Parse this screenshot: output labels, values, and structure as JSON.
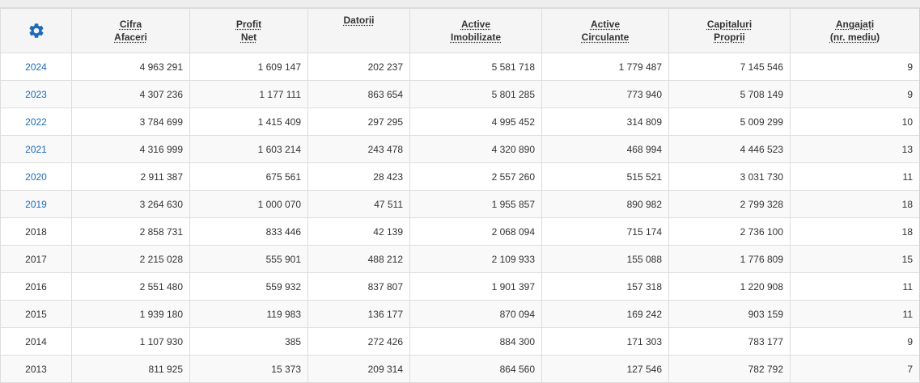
{
  "colors": {
    "accent": "#1e6bb8",
    "header_bg": "#f5f5f5",
    "border": "#dddddd",
    "text": "#333333"
  },
  "settings": {
    "icon": "gear-icon"
  },
  "columns": [
    {
      "key": "cifra_afaceri",
      "line1": "Cifra",
      "line2": "Afaceri"
    },
    {
      "key": "profit_net",
      "line1": "Profit",
      "line2": "Net"
    },
    {
      "key": "datorii",
      "line1": "Datorii",
      "line2": ""
    },
    {
      "key": "active_imobilizate",
      "line1": "Active",
      "line2": "Imobilizate"
    },
    {
      "key": "active_circulante",
      "line1": "Active",
      "line2": "Circulante"
    },
    {
      "key": "capitaluri_proprii",
      "line1": "Capitaluri",
      "line2": "Proprii"
    },
    {
      "key": "angajati",
      "line1": "Angajați",
      "line2": "(nr. mediu)"
    }
  ],
  "rows": [
    {
      "year": "2024",
      "link": true,
      "values": [
        "4 963 291",
        "1 609 147",
        "202 237",
        "5 581 718",
        "1 779 487",
        "7 145 546",
        "9"
      ]
    },
    {
      "year": "2023",
      "link": true,
      "values": [
        "4 307 236",
        "1 177 111",
        "863 654",
        "5 801 285",
        "773 940",
        "5 708 149",
        "9"
      ]
    },
    {
      "year": "2022",
      "link": true,
      "values": [
        "3 784 699",
        "1 415 409",
        "297 295",
        "4 995 452",
        "314 809",
        "5 009 299",
        "10"
      ]
    },
    {
      "year": "2021",
      "link": true,
      "values": [
        "4 316 999",
        "1 603 214",
        "243 478",
        "4 320 890",
        "468 994",
        "4 446 523",
        "13"
      ]
    },
    {
      "year": "2020",
      "link": true,
      "values": [
        "2 911 387",
        "675 561",
        "28 423",
        "2 557 260",
        "515 521",
        "3 031 730",
        "11"
      ]
    },
    {
      "year": "2019",
      "link": true,
      "values": [
        "3 264 630",
        "1 000 070",
        "47 511",
        "1 955 857",
        "890 982",
        "2 799 328",
        "18"
      ]
    },
    {
      "year": "2018",
      "link": false,
      "values": [
        "2 858 731",
        "833 446",
        "42 139",
        "2 068 094",
        "715 174",
        "2 736 100",
        "18"
      ]
    },
    {
      "year": "2017",
      "link": false,
      "values": [
        "2 215 028",
        "555 901",
        "488 212",
        "2 109 933",
        "155 088",
        "1 776 809",
        "15"
      ]
    },
    {
      "year": "2016",
      "link": false,
      "values": [
        "2 551 480",
        "559 932",
        "837 807",
        "1 901 397",
        "157 318",
        "1 220 908",
        "11"
      ]
    },
    {
      "year": "2015",
      "link": false,
      "values": [
        "1 939 180",
        "119 983",
        "136 177",
        "870 094",
        "169 242",
        "903 159",
        "11"
      ]
    },
    {
      "year": "2014",
      "link": false,
      "values": [
        "1 107 930",
        "385",
        "272 426",
        "884 300",
        "171 303",
        "783 177",
        "9"
      ]
    },
    {
      "year": "2013",
      "link": false,
      "values": [
        "811 925",
        "15 373",
        "209 314",
        "864 560",
        "127 546",
        "782 792",
        "7"
      ]
    }
  ]
}
